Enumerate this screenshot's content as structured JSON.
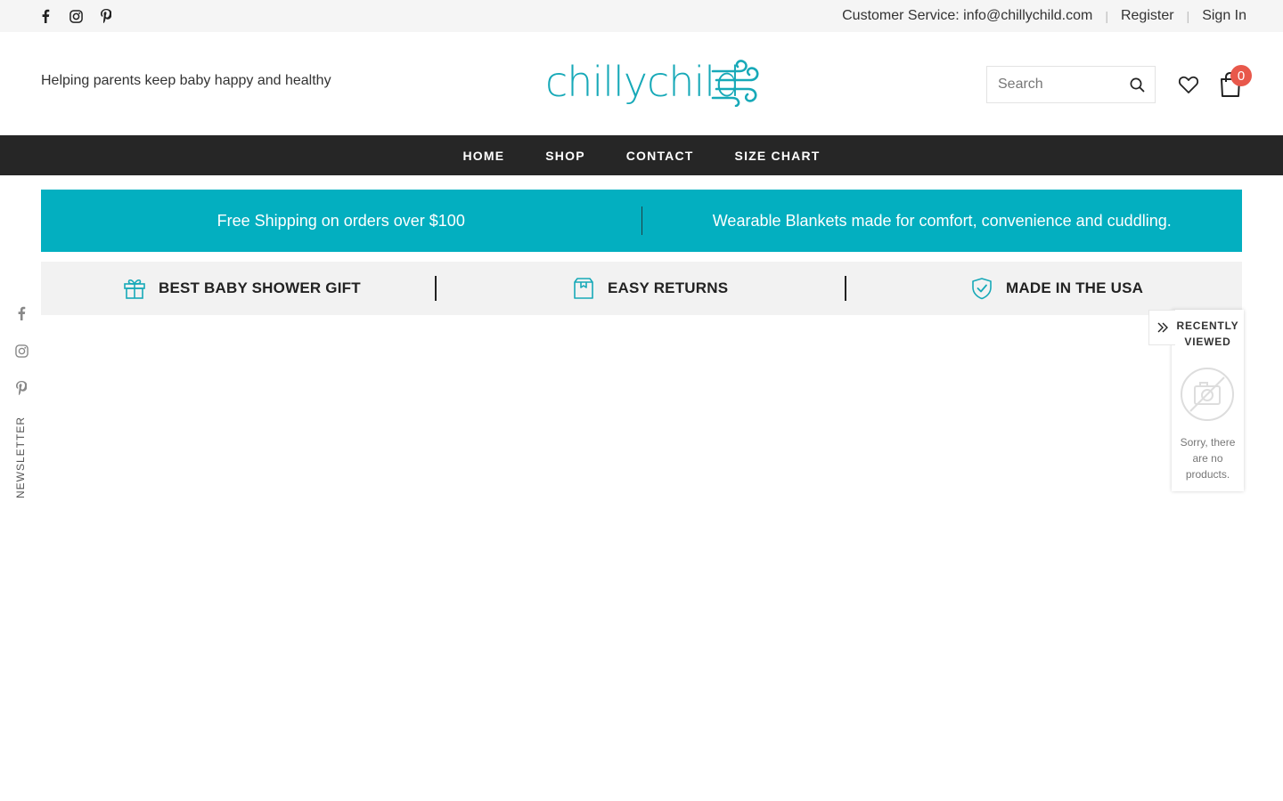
{
  "topbar": {
    "social_icons": [
      "facebook-icon",
      "instagram-icon",
      "pinterest-icon"
    ],
    "customer_service": "Customer Service: info@chillychild.com",
    "register": "Register",
    "sign_in": "Sign In"
  },
  "header": {
    "tagline": "Helping parents keep baby happy and healthy",
    "logo_text": "chillychild",
    "search_placeholder": "Search",
    "cart_count": "0"
  },
  "nav": {
    "items": [
      "HOME",
      "SHOP",
      "CONTACT",
      "SIZE CHART"
    ]
  },
  "promo": {
    "left": "Free Shipping on orders over $100",
    "right": "Wearable Blankets made for comfort, convenience and cuddling."
  },
  "features": [
    {
      "icon": "gift-icon",
      "label": "BEST BABY SHOWER GIFT"
    },
    {
      "icon": "box-icon",
      "label": "EASY RETURNS"
    },
    {
      "icon": "shield-check-icon",
      "label": "MADE IN THE USA"
    }
  ],
  "side": {
    "social_icons": [
      "facebook-icon",
      "instagram-icon",
      "pinterest-icon"
    ],
    "newsletter": "NEWSLETTER"
  },
  "recently_viewed": {
    "title": "RECENTLY VIEWED",
    "empty_message": "Sorry, there are no products."
  },
  "colors": {
    "brand": "#17a9b8",
    "promo_bg": "#03afc0",
    "nav_bg": "#262626",
    "badge": "#e8584b"
  }
}
